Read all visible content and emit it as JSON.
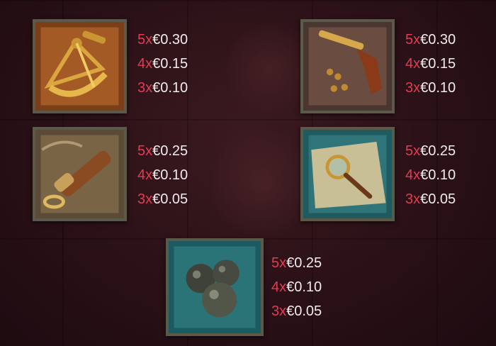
{
  "paytable": [
    {
      "symbol": "sextant-icon",
      "rows": [
        {
          "mult": "5x",
          "value": "€0.30"
        },
        {
          "mult": "4x",
          "value": "€0.15"
        },
        {
          "mult": "3x",
          "value": "€0.10"
        }
      ]
    },
    {
      "symbol": "pistol-icon",
      "rows": [
        {
          "mult": "5x",
          "value": "€0.30"
        },
        {
          "mult": "4x",
          "value": "€0.15"
        },
        {
          "mult": "3x",
          "value": "€0.10"
        }
      ]
    },
    {
      "symbol": "spyglass-icon",
      "rows": [
        {
          "mult": "5x",
          "value": "€0.25"
        },
        {
          "mult": "4x",
          "value": "€0.10"
        },
        {
          "mult": "3x",
          "value": "€0.05"
        }
      ]
    },
    {
      "symbol": "magnifier-map-icon",
      "rows": [
        {
          "mult": "5x",
          "value": "€0.25"
        },
        {
          "mult": "4x",
          "value": "€0.10"
        },
        {
          "mult": "3x",
          "value": "€0.05"
        }
      ]
    },
    {
      "symbol": "cannonballs-icon",
      "rows": [
        {
          "mult": "5x",
          "value": "€0.25"
        },
        {
          "mult": "4x",
          "value": "€0.10"
        },
        {
          "mult": "3x",
          "value": "€0.05"
        }
      ]
    }
  ],
  "colors": {
    "multiplier": "#e23c54",
    "value": "#f2ecec",
    "frame": "#5b5a4a"
  }
}
